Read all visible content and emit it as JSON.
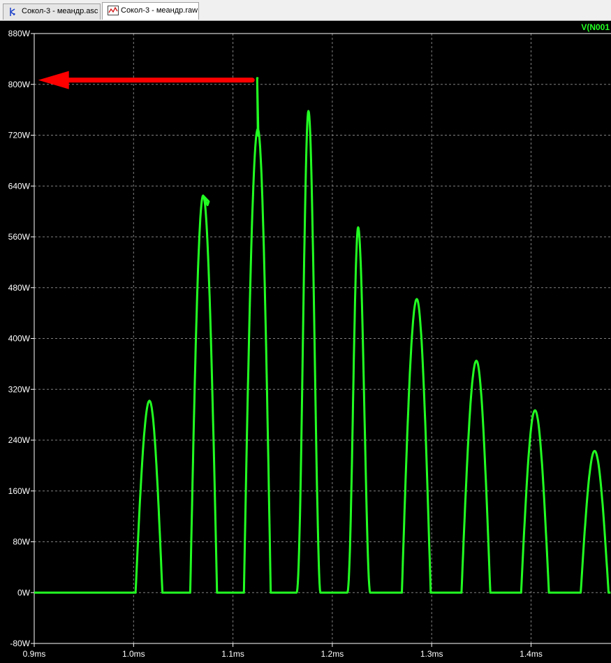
{
  "tabs": [
    {
      "label": "Сокол-3 - меандр.asc",
      "icon": "schematic-icon",
      "active": false
    },
    {
      "label": "Сокол-3 - меандр.raw",
      "icon": "waveform-icon",
      "active": true
    }
  ],
  "colors": {
    "background": "#000000",
    "trace": "#22ff22",
    "grid": "#808080",
    "axis_text": "#ffffff",
    "annotation_arrow": "#ff0000"
  },
  "chart_data": {
    "type": "line",
    "title": "",
    "xlabel": "",
    "ylabel": "",
    "grid": true,
    "xlim": [
      0.9,
      1.48
    ],
    "ylim": [
      -80,
      880
    ],
    "x_unit": "ms",
    "y_unit": "W",
    "x_ticks": [
      0.9,
      1.0,
      1.1,
      1.2,
      1.3,
      1.4
    ],
    "x_tick_labels": [
      "0.9ms",
      "1.0ms",
      "1.1ms",
      "1.2ms",
      "1.3ms",
      "1.4ms"
    ],
    "y_ticks": [
      880,
      800,
      720,
      640,
      560,
      480,
      400,
      320,
      240,
      160,
      80,
      0,
      -80
    ],
    "y_tick_labels": [
      "880W",
      "800W",
      "720W",
      "640W",
      "560W",
      "480W",
      "400W",
      "320W",
      "240W",
      "160W",
      "80W",
      "0W",
      "-80W"
    ],
    "series": [
      {
        "name": "V(N001",
        "color": "#22ff22",
        "pulses": [
          {
            "start": 1.002,
            "peak_x": 1.016,
            "peak": 302,
            "end": 1.029,
            "shape": "arch",
            "drop_at": 1.028,
            "drop_to": 180
          },
          {
            "start": 1.057,
            "peak_x": 1.07,
            "peak": 625,
            "end": 1.084,
            "shape": "arch",
            "spike_x": 1.075,
            "spike": 610
          },
          {
            "start": 1.111,
            "peak_x": 1.125,
            "peak": 810,
            "end": 1.138,
            "shape": "arch",
            "spike_x": 1.125,
            "spike": 810,
            "base_peak": 730
          },
          {
            "start": 1.164,
            "peak_x": 1.176,
            "peak": 758,
            "end": 1.188,
            "shape": "sharp"
          },
          {
            "start": 1.215,
            "peak_x": 1.226,
            "peak": 575,
            "end": 1.238,
            "shape": "sharp"
          },
          {
            "start": 1.27,
            "peak_x": 1.285,
            "peak": 462,
            "end": 1.299,
            "shape": "arch"
          },
          {
            "start": 1.33,
            "peak_x": 1.345,
            "peak": 365,
            "end": 1.359,
            "shape": "arch"
          },
          {
            "start": 1.39,
            "peak_x": 1.404,
            "peak": 287,
            "end": 1.418,
            "shape": "arch"
          },
          {
            "start": 1.45,
            "peak_x": 1.464,
            "peak": 223,
            "end": 1.478,
            "shape": "arch"
          }
        ]
      }
    ],
    "annotations": [
      {
        "type": "arrow",
        "color": "#ff0000",
        "from_x": 1.125,
        "from_y": 810,
        "to_x": 0.904,
        "to_y": 810
      }
    ]
  }
}
